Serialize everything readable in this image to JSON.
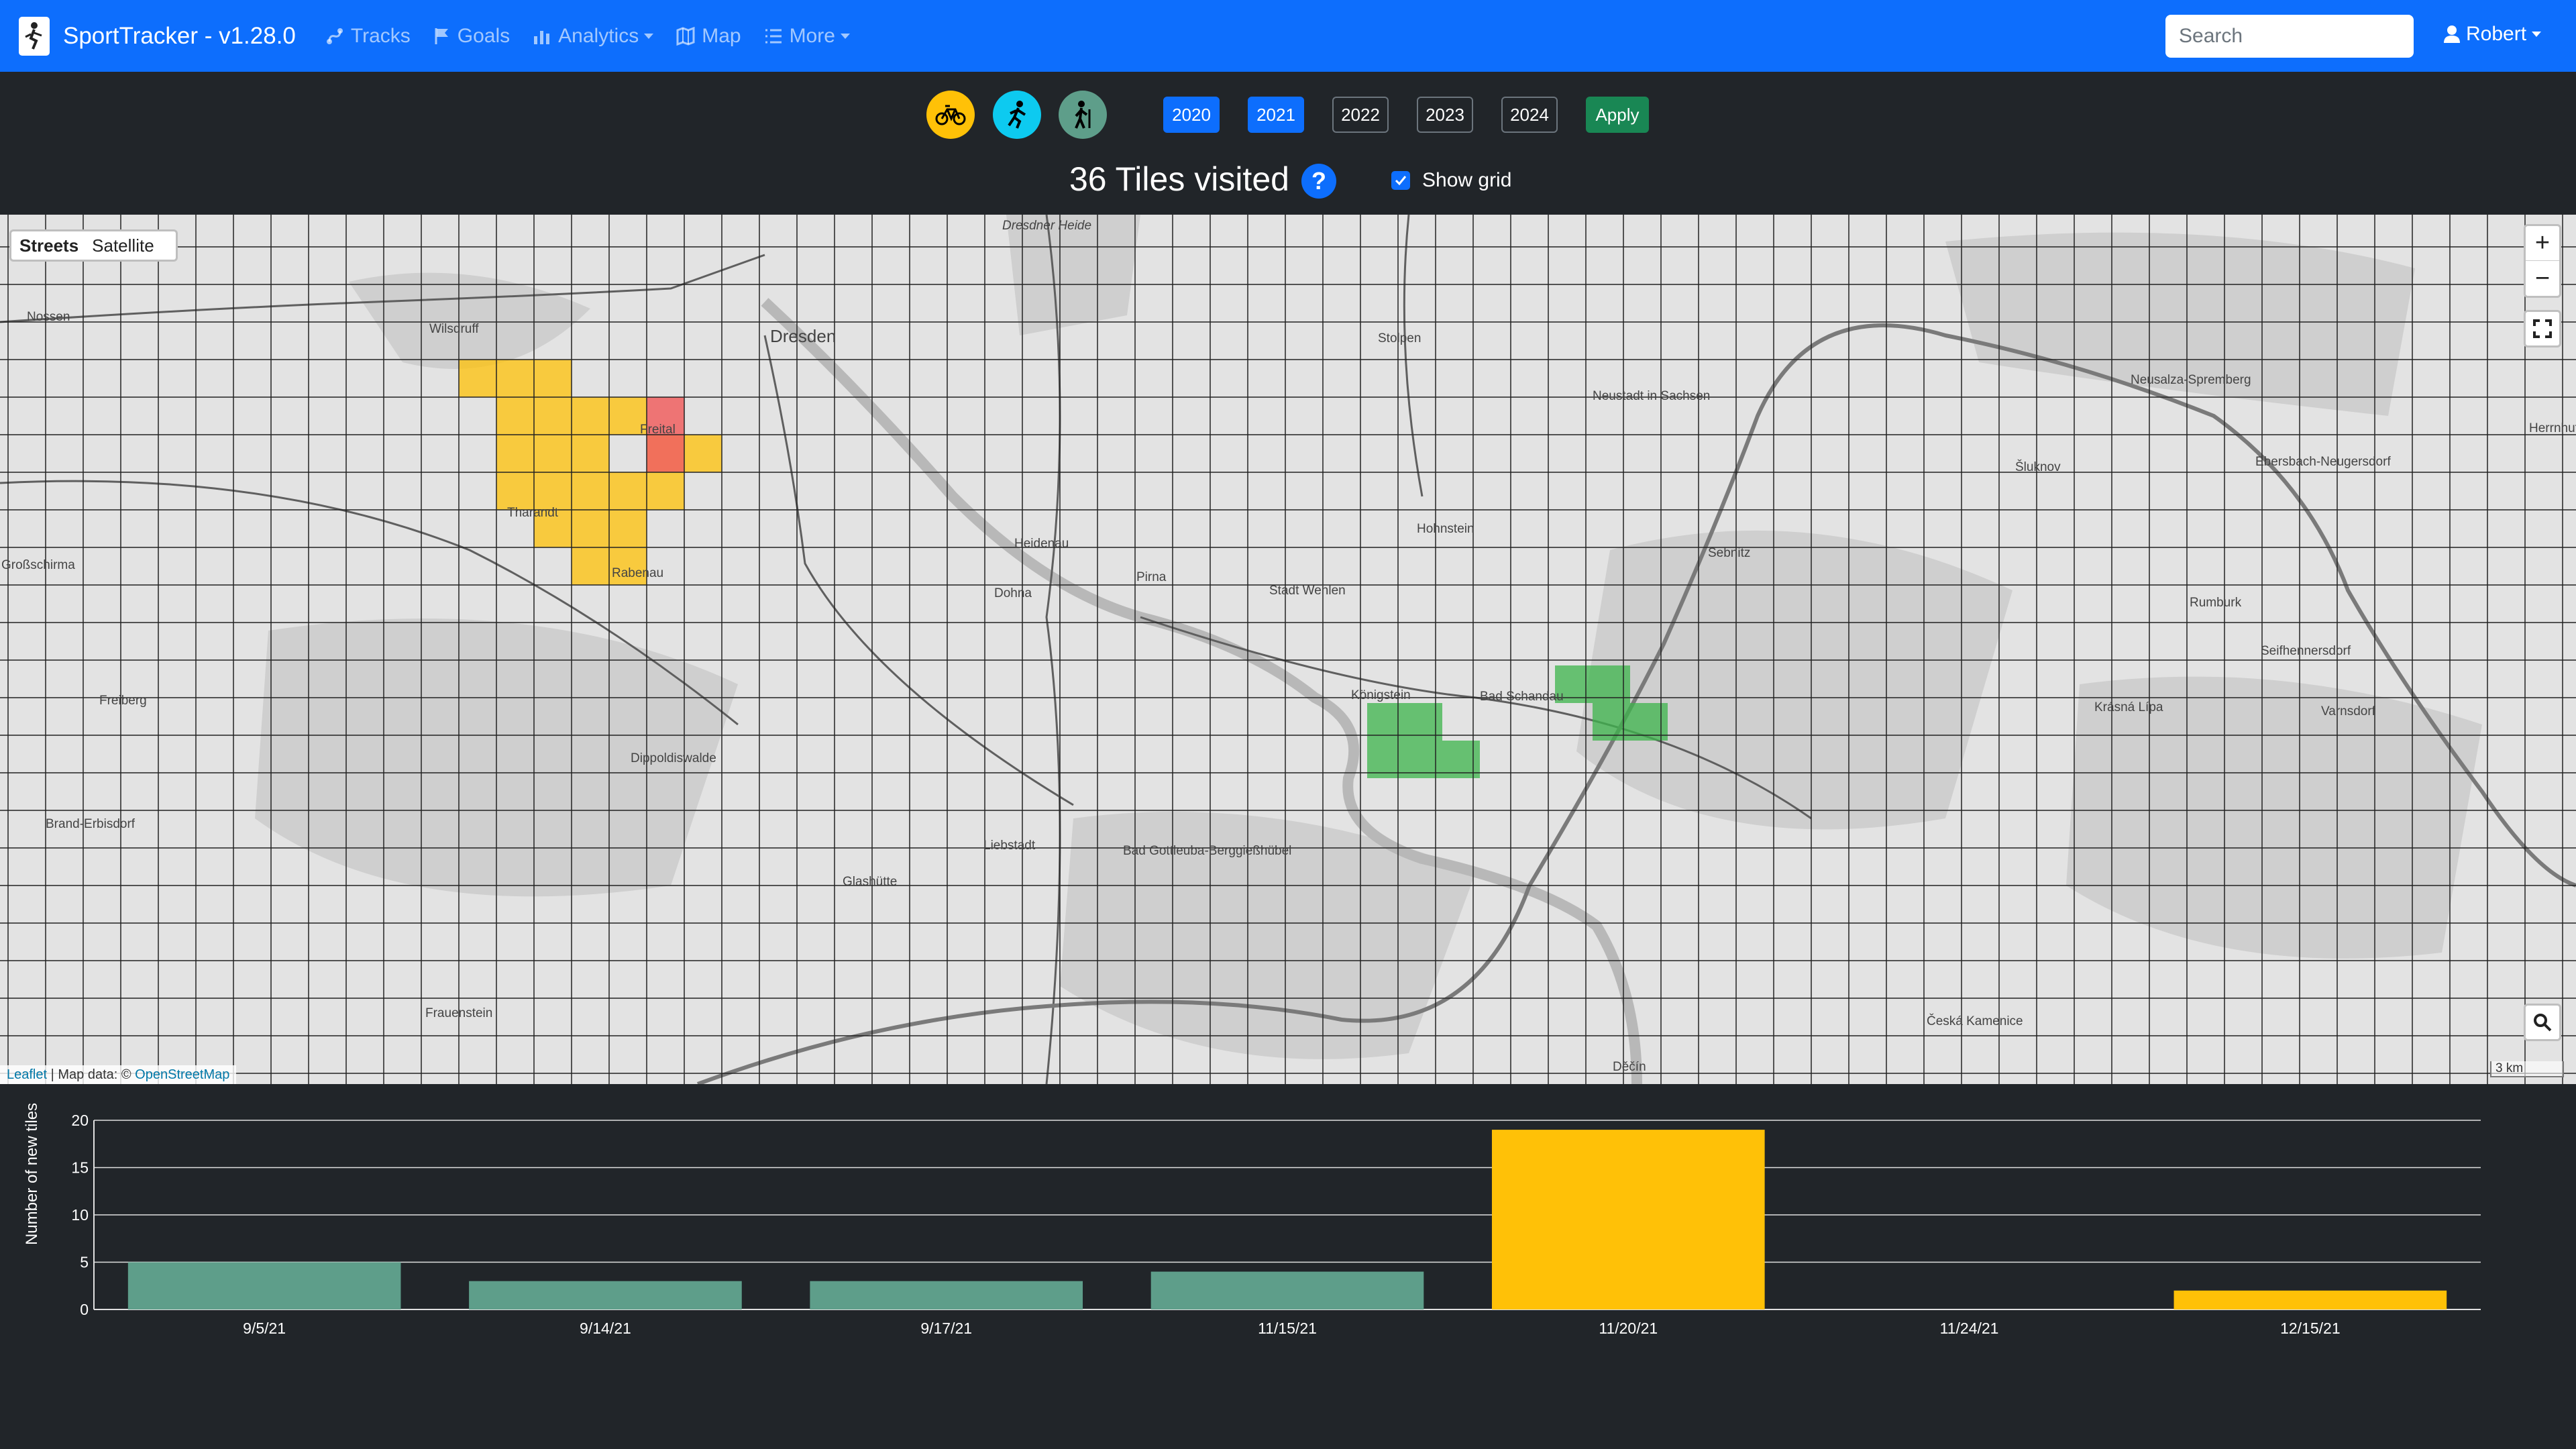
{
  "navbar": {
    "brand": "SportTracker - v1.28.0",
    "links": [
      {
        "label": "Tracks",
        "icon": "route-icon"
      },
      {
        "label": "Goals",
        "icon": "flag-icon"
      },
      {
        "label": "Analytics",
        "icon": "bar-chart-icon",
        "dropdown": true
      },
      {
        "label": "Map",
        "icon": "map-icon"
      },
      {
        "label": "More",
        "icon": "list-icon",
        "dropdown": true
      }
    ],
    "search_placeholder": "Search",
    "user": "Robert"
  },
  "filters": {
    "sports": [
      {
        "name": "bike",
        "color": "#ffc107"
      },
      {
        "name": "run",
        "color": "#0dcaf0"
      },
      {
        "name": "hike",
        "color": "#5e9e8a"
      }
    ],
    "years": [
      {
        "label": "2020",
        "active": true
      },
      {
        "label": "2021",
        "active": true
      },
      {
        "label": "2022",
        "active": false
      },
      {
        "label": "2023",
        "active": false
      },
      {
        "label": "2024",
        "active": false
      }
    ],
    "apply": "Apply"
  },
  "summary": {
    "title": "36 Tiles visited",
    "help": "?",
    "show_grid": "Show grid"
  },
  "map": {
    "layers": [
      "Streets",
      "Satellite"
    ],
    "active_layer": "Streets",
    "zoom_in": "+",
    "zoom_out": "−",
    "attribution_leaflet": "Leaflet",
    "attribution_sep": " | Map data: © ",
    "attribution_osm": "OpenStreetMap",
    "scale": "3 km",
    "places": [
      "Dresden",
      "Wilsdruff",
      "Nossen",
      "Freital",
      "Tharandt",
      "Rabenau",
      "Heidenau",
      "Dohna",
      "Pirna",
      "Stadt Wehlen",
      "Hohnstein",
      "Stolpen",
      "Neustadt in Sachsen",
      "Sebnitz",
      "Königstein",
      "Bad Schandau",
      "Dippoldiswalde",
      "Liebstadt",
      "Glashütte",
      "Bad Gottleuba-Berggießhübel",
      "Freiberg",
      "Brand-Erbisdorf",
      "Frauenstein",
      "Neusalza-Spremberg",
      "Šluknov",
      "Ebersbach-Neugersdorf",
      "Rumburk",
      "Seifhennersdorf",
      "Varnsdorf",
      "Krásná Lípa",
      "Česká Kamenice",
      "Děčín",
      "Herrnhut",
      "Dresdner Heide",
      "Großschirma"
    ],
    "tile_colors": {
      "cycling": "#ffc107",
      "hiking": "#3cb44b",
      "new": "#f06060"
    }
  },
  "chart_data": {
    "type": "bar",
    "ylabel": "Number of new tiles",
    "ylim": [
      0,
      20
    ],
    "yticks": [
      0,
      5,
      10,
      15,
      20
    ],
    "grid": true,
    "categories": [
      "9/5/21",
      "9/14/21",
      "9/17/21",
      "11/15/21",
      "11/20/21",
      "11/24/21",
      "12/15/21"
    ],
    "values": [
      5,
      3,
      3,
      4,
      19,
      0,
      2
    ],
    "colors": [
      "#5e9e8a",
      "#5e9e8a",
      "#5e9e8a",
      "#5e9e8a",
      "#ffc107",
      "#ffc107",
      "#ffc107"
    ]
  }
}
